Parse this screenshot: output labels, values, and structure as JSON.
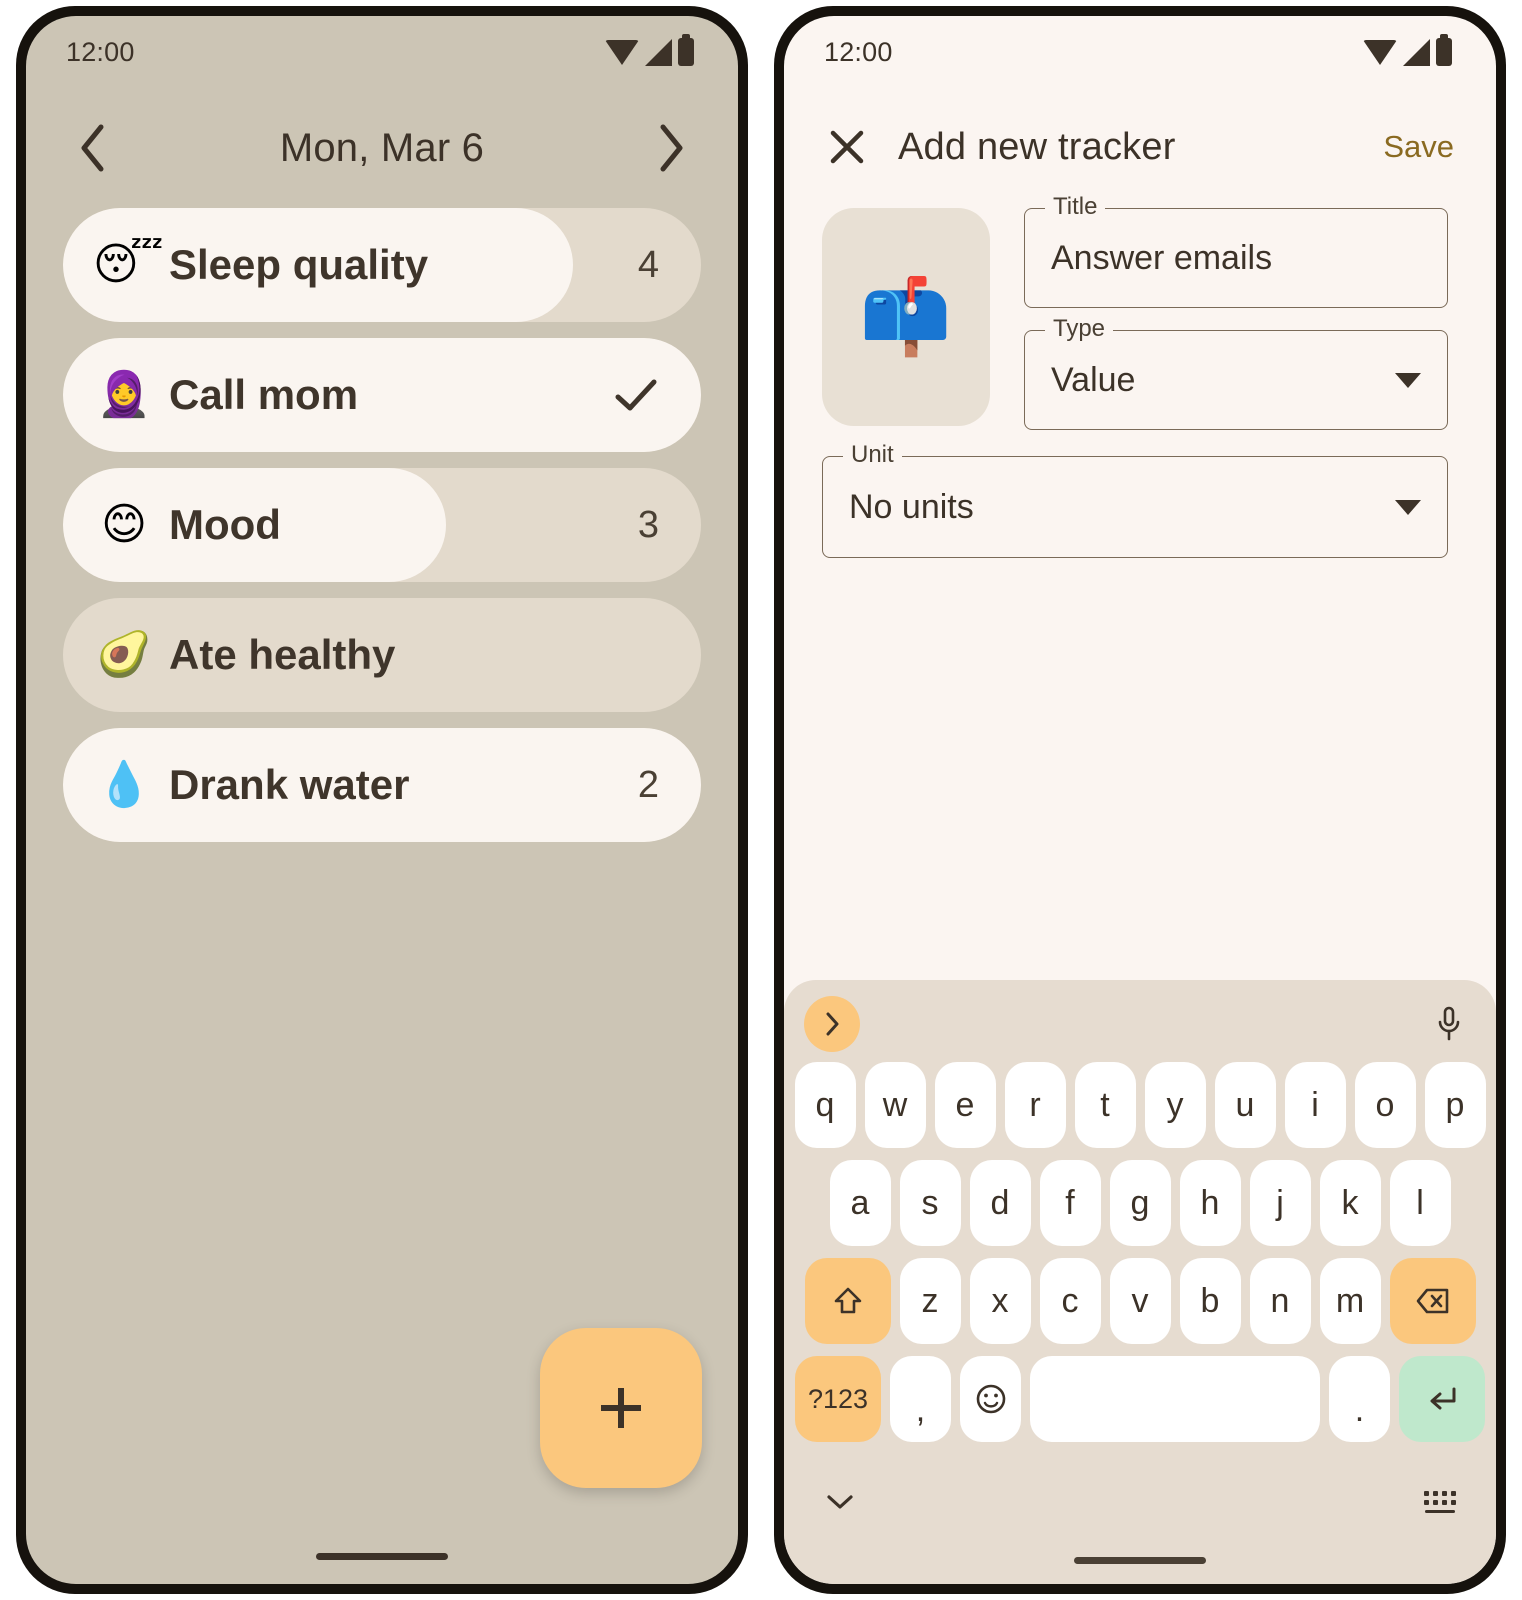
{
  "left_phone": {
    "status": {
      "time": "12:00",
      "icons": [
        "wifi-icon",
        "signal-icon",
        "battery-icon"
      ]
    },
    "header": {
      "prev_label": "‹",
      "title": "Mon, Mar 6",
      "next_label": "›"
    },
    "trackers": [
      {
        "emoji": "😴",
        "emoji_name": "sleeping-face-emoji",
        "label": "Sleep quality",
        "value": "4",
        "kind": "value",
        "fill_percent": 80
      },
      {
        "emoji": "🧕",
        "emoji_name": "woman-with-headscarf-emoji",
        "label": "Call mom",
        "value": "",
        "kind": "check",
        "fill_percent": 100
      },
      {
        "emoji": "😊",
        "emoji_name": "smiling-face-emoji",
        "label": "Mood",
        "value": "3",
        "kind": "value",
        "fill_percent": 60
      },
      {
        "emoji": "🥑",
        "emoji_name": "avocado-emoji",
        "label": "Ate healthy",
        "value": "",
        "kind": "none",
        "fill_percent": 0
      },
      {
        "emoji": "💧",
        "emoji_name": "droplet-emoji",
        "label": "Drank water",
        "value": "2",
        "kind": "value",
        "fill_percent": 100
      }
    ],
    "fab": {
      "label": "+",
      "name": "add-tracker-fab"
    }
  },
  "right_phone": {
    "status": {
      "time": "12:00"
    },
    "appbar": {
      "close_label": "✕",
      "title": "Add new tracker",
      "save_label": "Save"
    },
    "form": {
      "icon_emoji": "📫",
      "icon_emoji_name": "mailbox-emoji",
      "title_field": {
        "label": "Title",
        "value": "Answer emails",
        "placeholder": "Title"
      },
      "type_field": {
        "label": "Type",
        "value": "Value"
      },
      "unit_field": {
        "label": "Unit",
        "value": "No units"
      }
    },
    "keyboard": {
      "suggest": {
        "expand_icon": "chevron-right-icon",
        "mic_icon": "microphone-icon"
      },
      "row1": [
        "q",
        "w",
        "e",
        "r",
        "t",
        "y",
        "u",
        "i",
        "o",
        "p"
      ],
      "row2": [
        "a",
        "s",
        "d",
        "f",
        "g",
        "h",
        "j",
        "k",
        "l"
      ],
      "row3_shift": "⇧",
      "row3": [
        "z",
        "x",
        "c",
        "v",
        "b",
        "n",
        "m"
      ],
      "row3_backspace": "⌫",
      "row4_num": "?123",
      "row4_comma": ",",
      "row4_emoji": "☺",
      "row4_space": "",
      "row4_period": ".",
      "row4_enter": "↵",
      "bottom": {
        "hide_icon": "chevron-down-icon",
        "switch_icon": "keyboard-switch-icon"
      }
    }
  },
  "colors": {
    "accent_orange": "#fbc77d",
    "enter_green": "#bfe8cc",
    "save_amber": "#8a6a21",
    "left_bg": "#ccc5b5",
    "right_bg": "#fbf5f1",
    "track": "#e3dacc",
    "fill": "#faf5f0",
    "keyboard_bg": "#e6dcd0",
    "text": "#3c3228"
  }
}
